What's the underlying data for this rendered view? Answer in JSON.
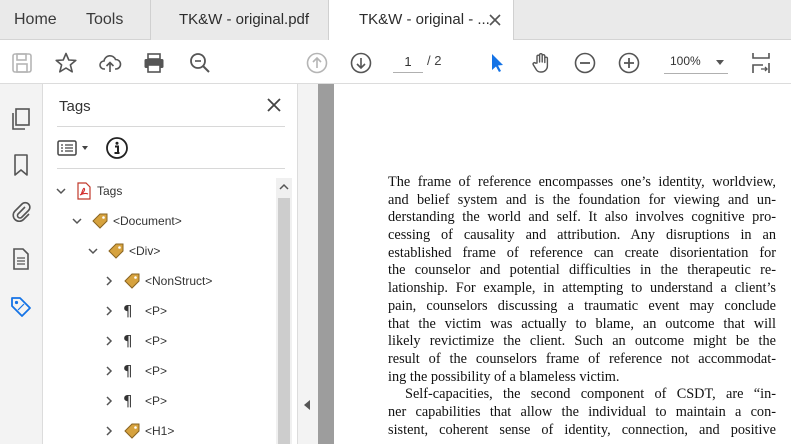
{
  "menu": {
    "home": "Home",
    "tools": "Tools"
  },
  "tabs": [
    {
      "label": "TK&W - original.pdf"
    },
    {
      "label": "TK&W - original - ..."
    }
  ],
  "toolbar": {
    "page_current": "1",
    "page_total": "/ 2",
    "zoom": "100%",
    "accent": "#1473e6",
    "icons": [
      "save-icon",
      "star-icon",
      "cloud-upload-icon",
      "print-icon",
      "zoom-search-icon",
      "prev-page-icon",
      "next-page-icon",
      "select-cursor-icon",
      "hand-icon",
      "zoom-out-icon",
      "zoom-in-icon",
      "page-fit-icon"
    ]
  },
  "rail": {
    "icons": [
      "pages-icon",
      "bookmark-icon",
      "attachment-icon",
      "document-icon",
      "tag-icon"
    ]
  },
  "tags_panel": {
    "title": "Tags",
    "tree": [
      {
        "label": "Tags",
        "icon": "pdf-icon"
      },
      {
        "label": "<Document>",
        "icon": "tag-icon"
      },
      {
        "label": "<Div>",
        "icon": "tag-icon"
      },
      {
        "label": "<NonStruct>",
        "icon": "tag-icon"
      },
      {
        "label": "<P>",
        "icon": "paragraph-icon"
      },
      {
        "label": "<P>",
        "icon": "paragraph-icon"
      },
      {
        "label": "<P>",
        "icon": "paragraph-icon"
      },
      {
        "label": "<P>",
        "icon": "paragraph-icon"
      },
      {
        "label": "<H1>",
        "icon": "tag-icon"
      }
    ]
  },
  "document": {
    "lines": [
      "The frame of reference encompasses one’s identity, worldview,",
      "and belief system and is the foundation for viewing and un-",
      "derstanding the world and self. It also involves cognitive pro-",
      "cessing of causality and attribution. Any disruptions in an",
      "established frame of reference can create disorientation for",
      "the counselor and potential difficulties in the therapeutic re-",
      "lationship. For example, in attempting to understand a client’s",
      "pain, counselors discussing a traumatic event may conclude",
      "that the victim was actually to blame, an outcome that will",
      "likely revictimize the client. Such an outcome might be the",
      "result of the counselors frame of reference not accommodat-",
      "ing the possibility of a blameless victim.",
      "Self-capacities, the second component of CSDT, are “in-",
      "ner capabilities that allow the individual to maintain a con-",
      "sistent, coherent sense of identity, connection, and positive"
    ]
  }
}
